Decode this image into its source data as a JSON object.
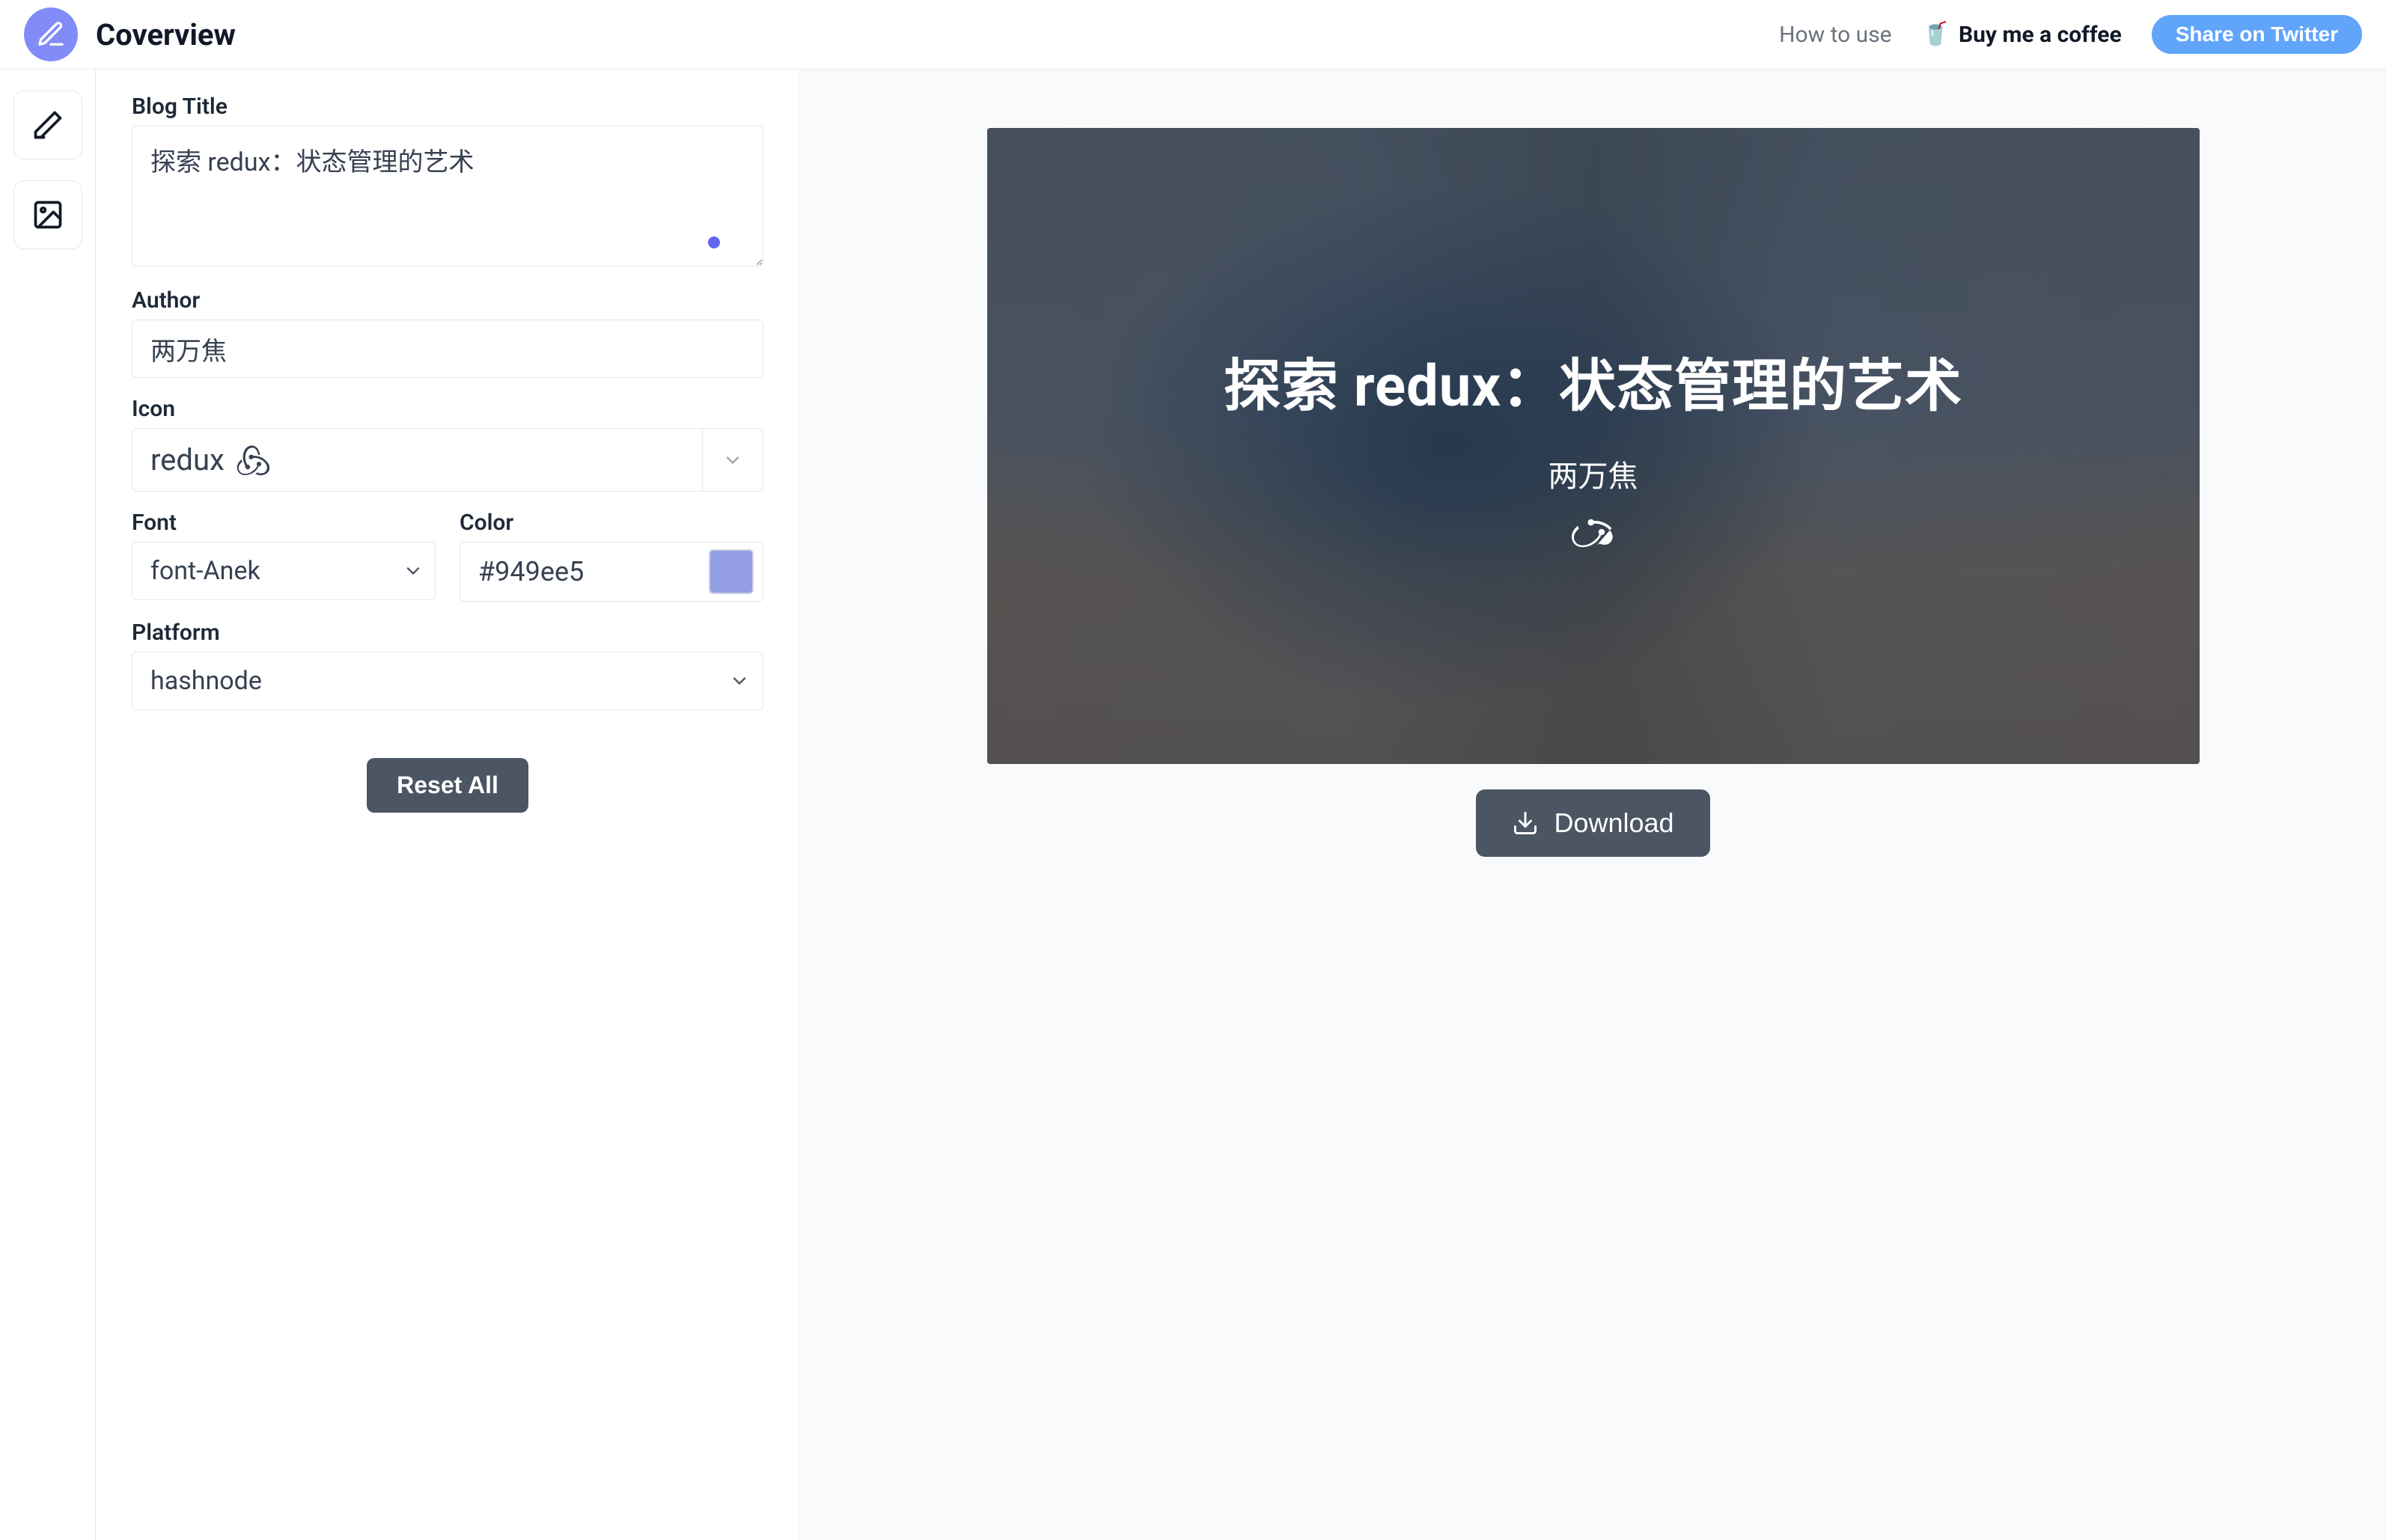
{
  "brand": {
    "name": "Coverview"
  },
  "header": {
    "how_to_use": "How to use",
    "coffee": "Buy me a coffee",
    "twitter": "Share on Twitter"
  },
  "labels": {
    "blog_title": "Blog Title",
    "author": "Author",
    "icon": "Icon",
    "font": "Font",
    "color": "Color",
    "platform": "Platform"
  },
  "form": {
    "blog_title_value": "探索 redux：状态管理的艺术",
    "author_value": "两万焦",
    "icon_value": "redux",
    "font_value": "font-Anek",
    "color_value": "#949ee5",
    "platform_value": "hashnode",
    "reset_label": "Reset All"
  },
  "preview": {
    "title": "探索 redux：状态管理的艺术",
    "author": "两万焦",
    "download_label": "Download"
  },
  "icons": {
    "brand": "edit-square-icon",
    "rail_edit": "pencil-icon",
    "rail_image": "image-icon",
    "redux": "redux-icon",
    "chevron": "chevron-down-icon",
    "download": "download-icon",
    "cup": "coffee-cup-icon"
  }
}
